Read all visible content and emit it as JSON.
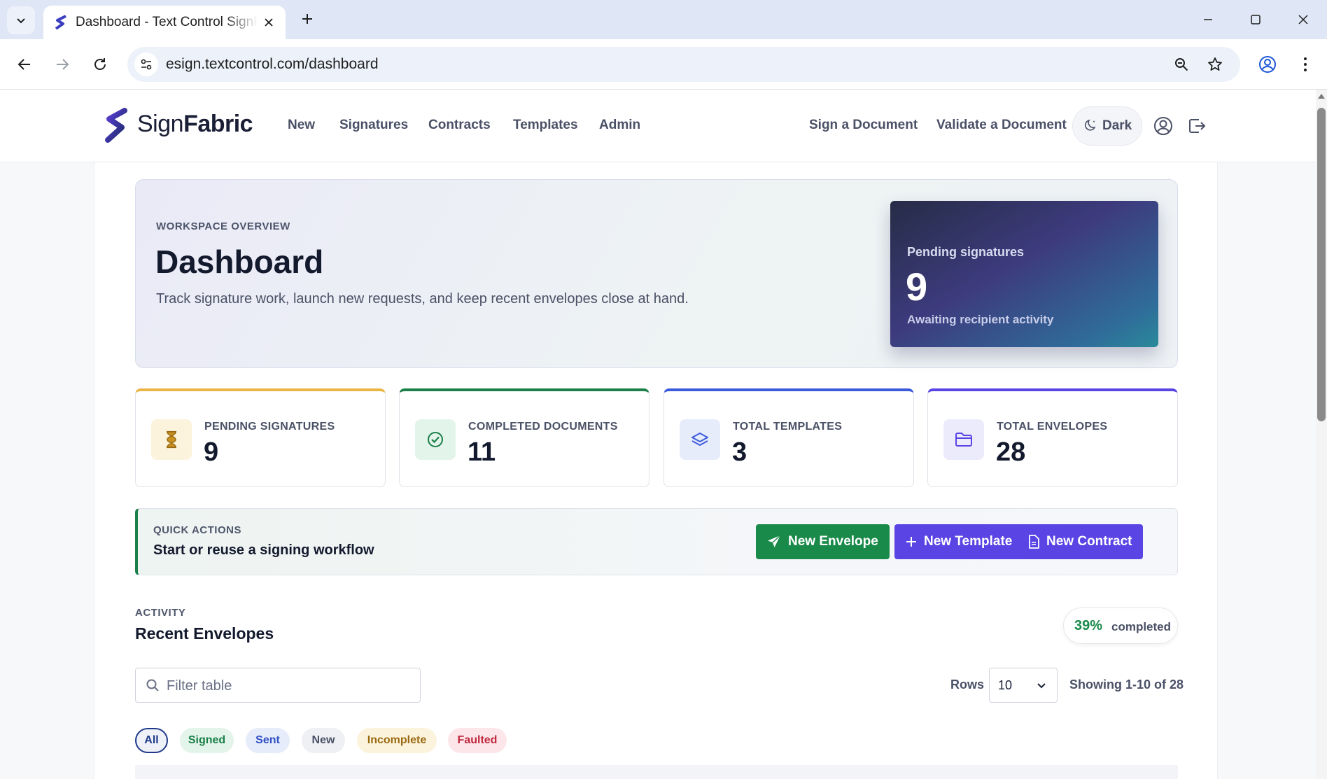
{
  "browser": {
    "tab_title": "Dashboard - Text Control SignFabric",
    "url": "esign.textcontrol.com/dashboard"
  },
  "header": {
    "logo_light": "Sign",
    "logo_bold": "Fabric",
    "nav": [
      "New",
      "Signatures",
      "Contracts",
      "Templates",
      "Admin"
    ],
    "right_nav": [
      "Sign a Document",
      "Validate a Document"
    ],
    "dark_label": "Dark"
  },
  "hero": {
    "eyebrow": "WORKSPACE OVERVIEW",
    "title": "Dashboard",
    "description": "Track signature work, launch new requests, and keep recent envelopes close at hand.",
    "card_label": "Pending signatures",
    "card_value": "9",
    "card_sub": "Awaiting recipient activity"
  },
  "stats": [
    {
      "label": "PENDING SIGNATURES",
      "value": "9",
      "icon": "hourglass-icon",
      "accent": "#e9b545",
      "icon_bg": "#fcf3dc",
      "icon_color": "#9a6a12"
    },
    {
      "label": "COMPLETED DOCUMENTS",
      "value": "11",
      "icon": "check-circle-icon",
      "accent": "#1a7f48",
      "icon_bg": "#e3f4ea",
      "icon_color": "#1a7f48"
    },
    {
      "label": "TOTAL TEMPLATES",
      "value": "3",
      "icon": "layers-icon",
      "accent": "#3b5bdb",
      "icon_bg": "#e7ecfb",
      "icon_color": "#3b5bdb"
    },
    {
      "label": "TOTAL ENVELOPES",
      "value": "28",
      "icon": "folder-icon",
      "accent": "#5a44e4",
      "icon_bg": "#ecebfc",
      "icon_color": "#5a44e4"
    }
  ],
  "quick": {
    "eyebrow": "QUICK ACTIONS",
    "title": "Start or reuse a signing workflow",
    "new_envelope": "New Envelope",
    "new_template": "New Template",
    "new_contract": "New Contract"
  },
  "activity": {
    "eyebrow": "ACTIVITY",
    "title": "Recent Envelopes",
    "progress_value": "39%",
    "progress_label": "completed",
    "filter_placeholder": "Filter table",
    "rows_label": "Rows",
    "rows_value": "10",
    "showing": "Showing 1-10 of 28",
    "chips": [
      {
        "label": "All",
        "bg": "#eef1f8",
        "color": "#1f3a8a",
        "border": "#1f3a8a"
      },
      {
        "label": "Signed",
        "bg": "#e3f4ea",
        "color": "#1a7f48",
        "border": "transparent"
      },
      {
        "label": "Sent",
        "bg": "#e7ecfb",
        "color": "#2f4fc4",
        "border": "transparent"
      },
      {
        "label": "New",
        "bg": "#eef0f4",
        "color": "#4a5066",
        "border": "transparent"
      },
      {
        "label": "Incomplete",
        "bg": "#fcf3dc",
        "color": "#9a6a12",
        "border": "transparent"
      },
      {
        "label": "Faulted",
        "bg": "#fde6ea",
        "color": "#c0283c",
        "border": "transparent"
      }
    ]
  }
}
